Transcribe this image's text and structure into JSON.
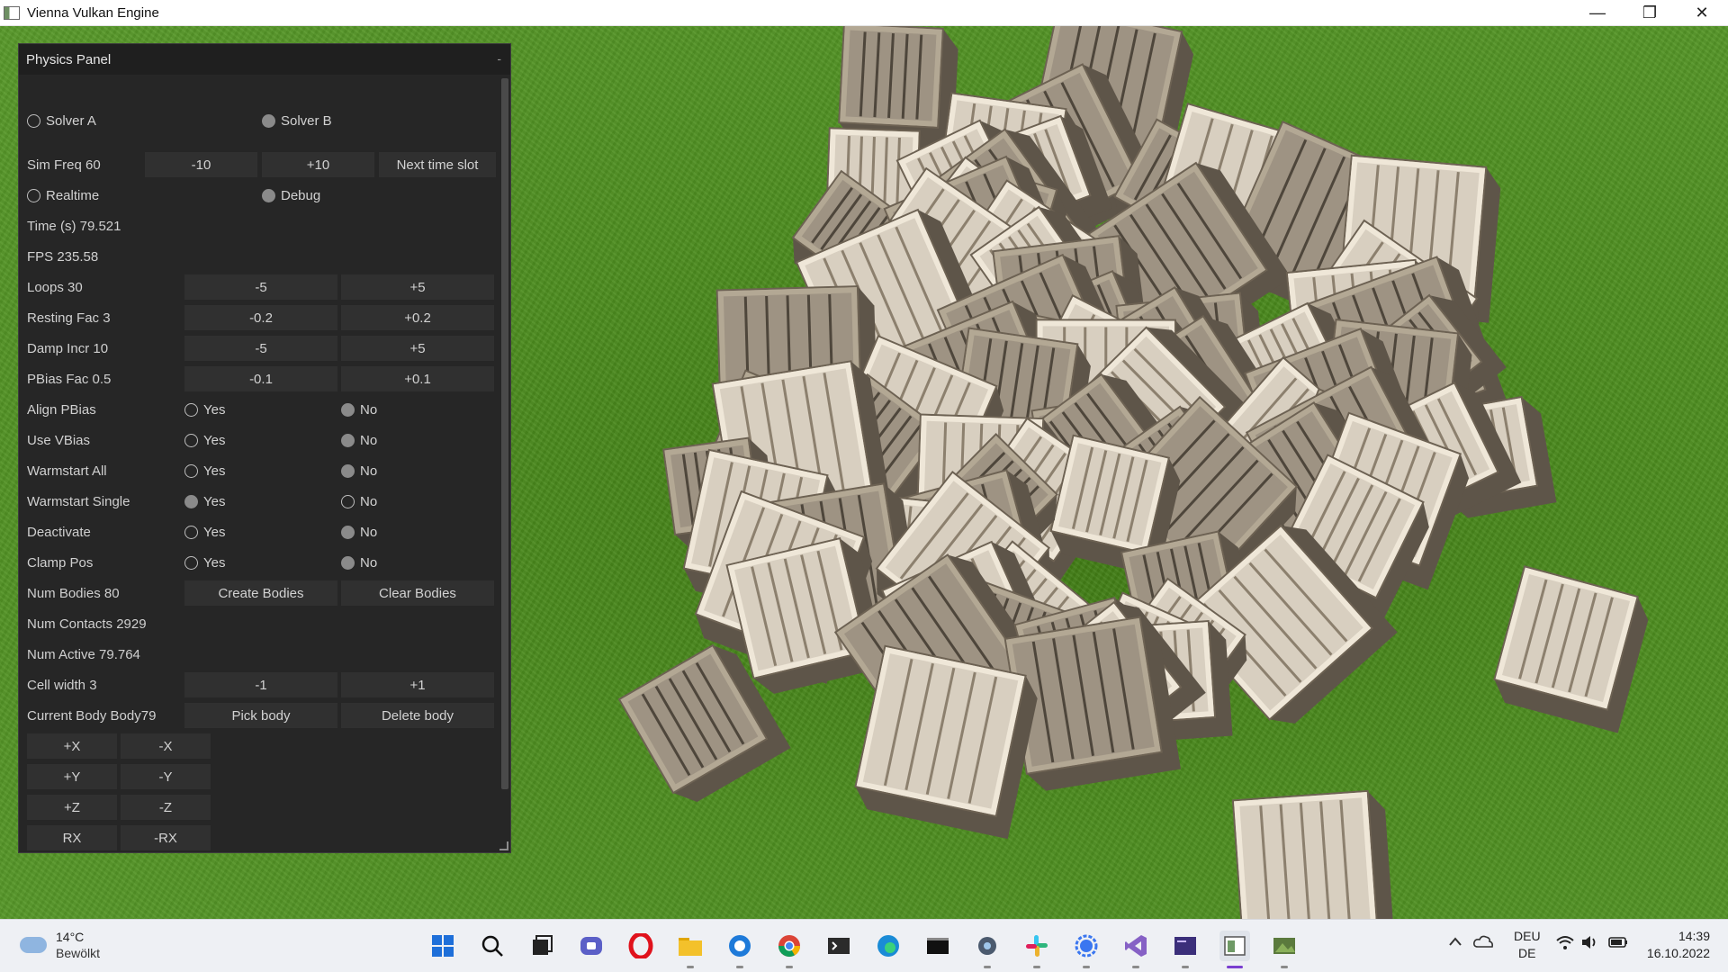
{
  "window": {
    "title": "Vienna Vulkan Engine"
  },
  "panel": {
    "title": "Physics Panel",
    "solver_a": "Solver A",
    "solver_b": "Solver B",
    "sim_freq": "Sim Freq 60",
    "sim_minus": "-10",
    "sim_plus": "+10",
    "next_slot": "Next time slot",
    "realtime": "Realtime",
    "debug": "Debug",
    "time": "Time (s)  79.521",
    "fps": "FPS 235.58",
    "rows": [
      {
        "label": "Loops 30",
        "minus": "-5",
        "plus": "+5"
      },
      {
        "label": "Resting Fac 3",
        "minus": "-0.2",
        "plus": "+0.2"
      },
      {
        "label": "Damp Incr 10",
        "minus": "-5",
        "plus": "+5"
      },
      {
        "label": "PBias Fac 0.5",
        "minus": "-0.1",
        "plus": "+0.1"
      }
    ],
    "toggles": [
      {
        "label": "Align PBias",
        "yes": "Yes",
        "no": "No",
        "selected": "no"
      },
      {
        "label": "Use VBias",
        "yes": "Yes",
        "no": "No",
        "selected": "no"
      },
      {
        "label": "Warmstart All",
        "yes": "Yes",
        "no": "No",
        "selected": "no"
      },
      {
        "label": "Warmstart Single",
        "yes": "Yes",
        "no": "No",
        "selected": "yes"
      },
      {
        "label": "Deactivate",
        "yes": "Yes",
        "no": "No",
        "selected": "no"
      },
      {
        "label": "Clamp Pos",
        "yes": "Yes",
        "no": "No",
        "selected": "no"
      }
    ],
    "num_bodies": "Num Bodies 80",
    "create_bodies": "Create Bodies",
    "clear_bodies": "Clear Bodies",
    "num_contacts": "Num Contacts 2929",
    "num_active": "Num Active 79.764",
    "cell_width": "Cell width 3",
    "cell_minus": "-1",
    "cell_plus": "+1",
    "current_body": "Current Body Body79",
    "pick_body": "Pick body",
    "delete_body": "Delete body",
    "axis_buttons": [
      {
        "pos": "+X",
        "neg": "-X"
      },
      {
        "pos": "+Y",
        "neg": "-Y"
      },
      {
        "pos": "+Z",
        "neg": "-Z"
      },
      {
        "pos": "RX",
        "neg": "-RX"
      }
    ],
    "collapse_glyph": "-",
    "selected_solver": "b",
    "selected_mode": "debug"
  },
  "taskbar": {
    "weather_temp": "14°C",
    "weather_text": "Bewölkt",
    "lang_top": "DEU",
    "lang_bottom": "DE",
    "time": "14:39",
    "date": "16.10.2022",
    "apps": [
      "windows-start",
      "search",
      "task-view",
      "teams-chat",
      "opera",
      "file-explorer",
      "github-desktop",
      "chrome",
      "terminal",
      "edge",
      "console",
      "settings",
      "slack",
      "signal",
      "visual-studio",
      "vulkan-app",
      "active-window",
      "image-viewer"
    ]
  }
}
